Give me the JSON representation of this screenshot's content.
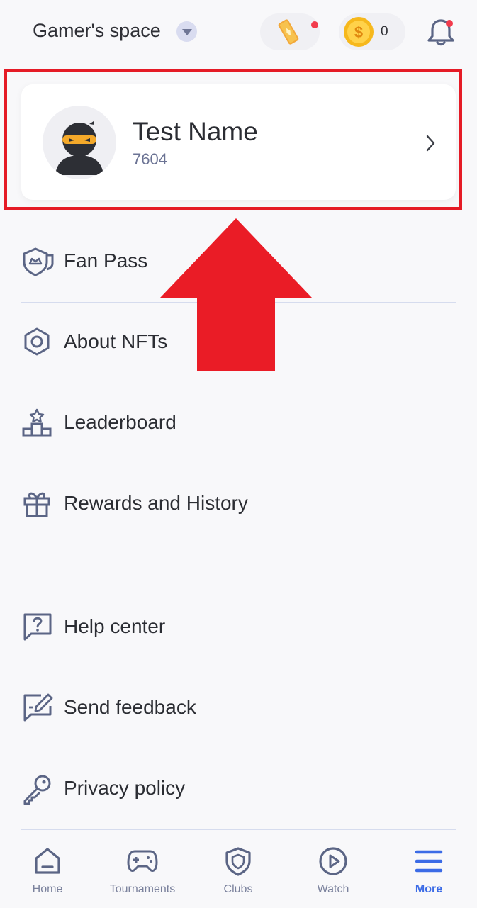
{
  "header": {
    "space_title": "Gamer's space",
    "coin_count": "0"
  },
  "profile": {
    "name": "Test Name",
    "id": "7604"
  },
  "menu": {
    "primary": [
      {
        "label": "Fan Pass",
        "icon": "fan-pass-shield-icon"
      },
      {
        "label": "About NFTs",
        "icon": "hexagon-icon"
      },
      {
        "label": "Leaderboard",
        "icon": "podium-icon"
      },
      {
        "label": "Rewards and History",
        "icon": "gift-icon"
      }
    ],
    "secondary": [
      {
        "label": "Help center",
        "icon": "help-icon"
      },
      {
        "label": "Send feedback",
        "icon": "feedback-icon"
      },
      {
        "label": "Privacy policy",
        "icon": "key-icon"
      }
    ]
  },
  "nav": [
    {
      "label": "Home",
      "icon": "home-icon"
    },
    {
      "label": "Tournaments",
      "icon": "gamepad-icon"
    },
    {
      "label": "Clubs",
      "icon": "shield-icon"
    },
    {
      "label": "Watch",
      "icon": "play-icon"
    },
    {
      "label": "More",
      "icon": "menu-icon",
      "active": true
    }
  ],
  "colors": {
    "accent": "#3b6be6",
    "highlight_red": "#e51b26",
    "icon_stroke": "#5b6585",
    "notification": "#f23b4c"
  }
}
